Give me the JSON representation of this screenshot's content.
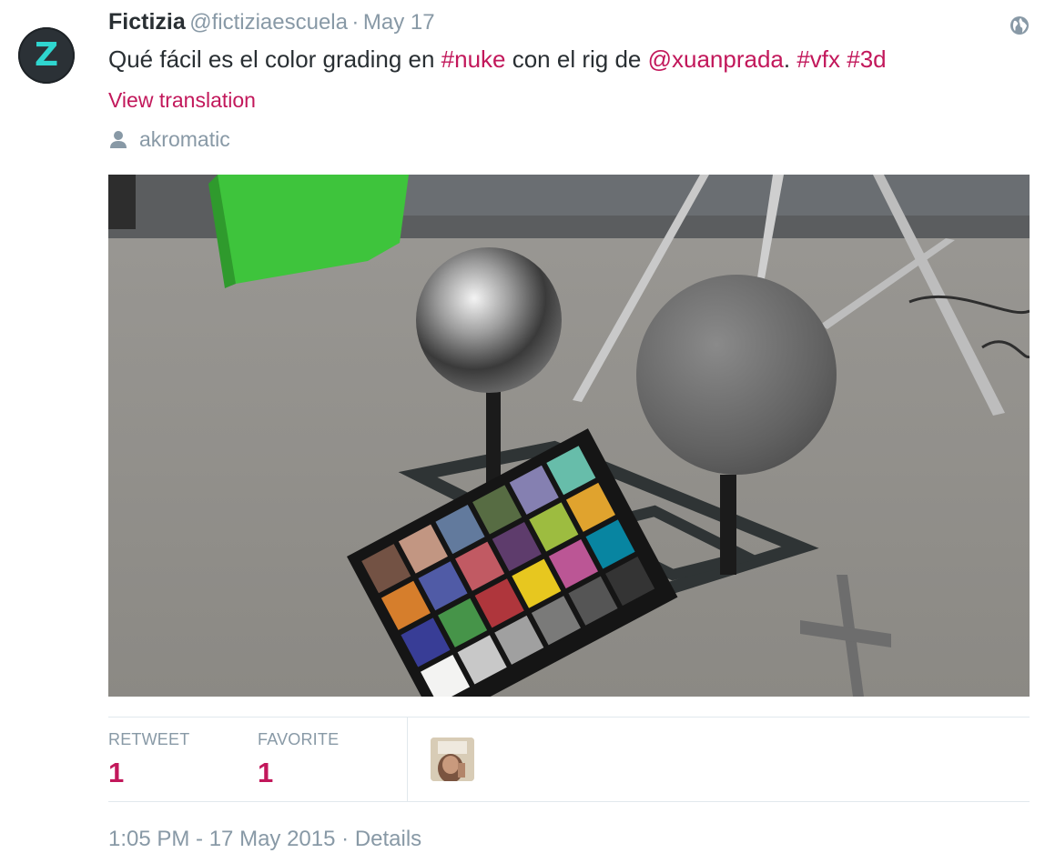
{
  "tweet": {
    "avatar_letter": "Z",
    "fullname": "Fictizia",
    "screen_name": "@fictiziaescuela",
    "separator": "·",
    "date": "May 17",
    "text_parts": {
      "t1": "Qué fácil es el color grading en ",
      "h1": "#nuke",
      "t2": " con el rig de ",
      "m1": "@xuanprada",
      "t3": ". ",
      "h2": "#vfx",
      "t4": " ",
      "h3": "#3d"
    },
    "view_translation": "View translation",
    "place": "akromatic"
  },
  "stats": {
    "retweet_label": "RETWEET",
    "retweet_count": "1",
    "favorite_label": "FAVORITE",
    "favorite_count": "1"
  },
  "footer": {
    "time": "1:05 PM - 17 May 2015",
    "separator": "·",
    "details_label": "Details"
  },
  "colors": {
    "link": "#c2185b",
    "muted": "#8899a6",
    "text": "#292f33",
    "avatar_bg": "#2b3136",
    "avatar_letter": "#2fd6cf"
  },
  "icons": {
    "globe": "globe-icon",
    "place": "person-icon"
  }
}
